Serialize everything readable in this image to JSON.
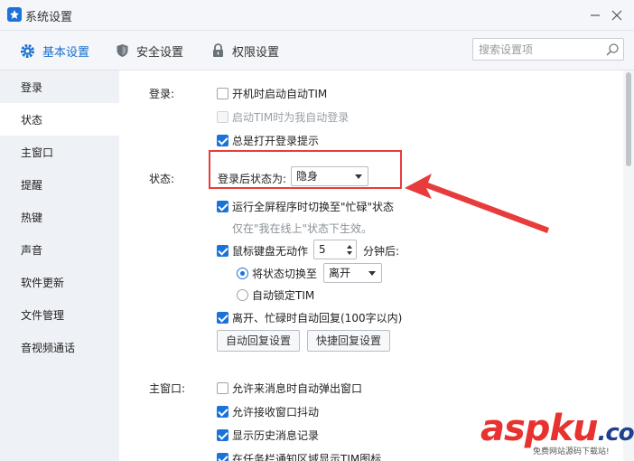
{
  "window": {
    "title": "系统设置"
  },
  "tabs": [
    {
      "label": "基本设置",
      "icon": "gear-icon",
      "active": true
    },
    {
      "label": "安全设置",
      "icon": "shield-icon",
      "active": false
    },
    {
      "label": "权限设置",
      "icon": "lock-icon",
      "active": false
    }
  ],
  "search": {
    "placeholder": "搜索设置项"
  },
  "sidebar": {
    "items": [
      {
        "label": "登录"
      },
      {
        "label": "状态"
      },
      {
        "label": "主窗口"
      },
      {
        "label": "提醒"
      },
      {
        "label": "热键"
      },
      {
        "label": "声音"
      },
      {
        "label": "软件更新"
      },
      {
        "label": "文件管理"
      },
      {
        "label": "音视频通话"
      }
    ],
    "active_index": 1
  },
  "login": {
    "section_label": "登录:",
    "auto_start": {
      "label": "开机时启动自动TIM",
      "checked": false
    },
    "auto_login": {
      "label": "启动TIM时为我自动登录",
      "checked": false,
      "disabled": true
    },
    "show_prompt": {
      "label": "总是打开登录提示",
      "checked": true
    }
  },
  "status": {
    "section_label": "状态:",
    "after_login_label": "登录后状态为:",
    "after_login_value": "隐身",
    "fullscreen_busy": {
      "label": "运行全屏程序时切换至\"忙碌\"状态",
      "checked": true
    },
    "fullscreen_hint": "仅在\"我在线上\"状态下生效。",
    "idle": {
      "label": "鼠标键盘无动作",
      "checked": true,
      "minutes": "5",
      "suffix": "分钟后:"
    },
    "switch_to": {
      "label": "将状态切换至",
      "checked": true,
      "value": "离开"
    },
    "auto_lock": {
      "label": "自动锁定TIM",
      "checked": false
    },
    "auto_reply": {
      "label": "离开、忙碌时自动回复(100字以内)",
      "checked": true
    },
    "buttons": {
      "auto_reply_settings": "自动回复设置",
      "quick_reply_settings": "快捷回复设置"
    }
  },
  "main_window": {
    "section_label": "主窗口:",
    "popup": {
      "label": "允许来消息时自动弹出窗口",
      "checked": false
    },
    "shake": {
      "label": "允许接收窗口抖动",
      "checked": true
    },
    "history": {
      "label": "显示历史消息记录",
      "checked": true
    },
    "taskbar": {
      "label": "在任务栏通知区域显示TIM图标",
      "checked": true
    }
  },
  "watermark": {
    "text": "aspku",
    "suffix": ".com",
    "sub": "免费网站源码下载站!"
  },
  "colors": {
    "accent": "#1a73d9",
    "annotation": "#e83c3c"
  }
}
